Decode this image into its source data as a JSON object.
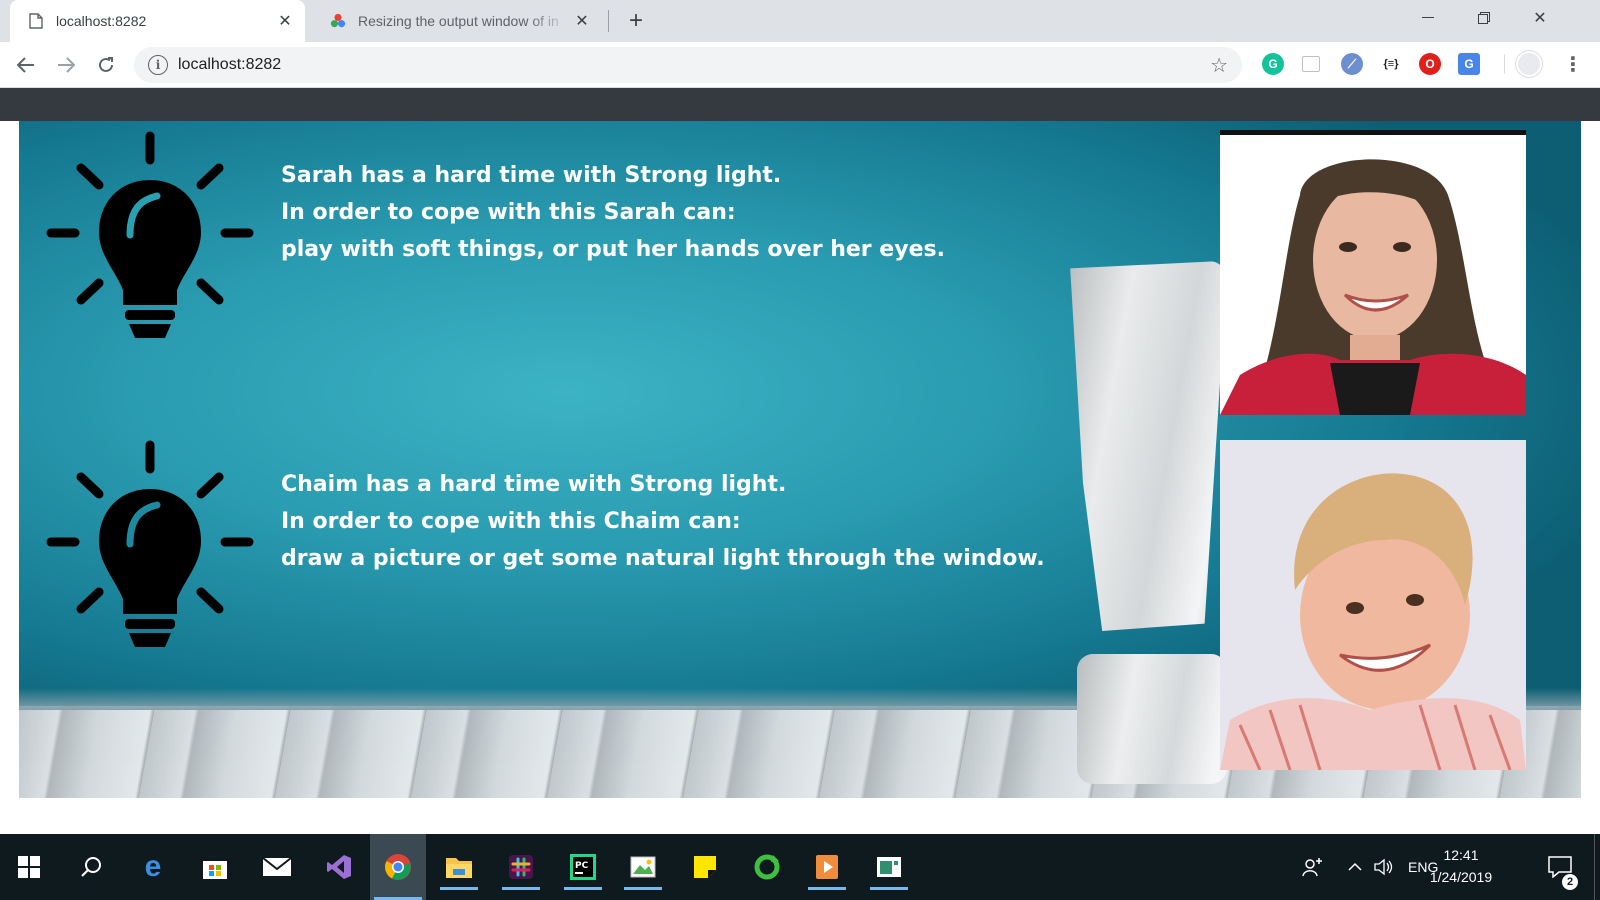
{
  "browser": {
    "tabs": [
      {
        "title": "localhost:8282",
        "active": true
      },
      {
        "title": "Resizing the output window of in",
        "active": false
      }
    ],
    "address_bar": {
      "url": "localhost:8282"
    },
    "extensions": [
      "grammarly-icon",
      "layout-icon",
      "feather-icon",
      "json-icon",
      "opera-icon",
      "translate-icon"
    ]
  },
  "slide": {
    "background_color": "#2a9bb0",
    "messages": [
      {
        "line1": "Sarah has a hard time with Strong light.",
        "line2": "In order to cope with this Sarah can:",
        "line3": "play with soft things, or put her hands over her eyes."
      },
      {
        "line1": "Chaim has a hard time with Strong light.",
        "line2": "In order to cope with this Chaim can:",
        "line3": "draw a picture or get some natural light through the window."
      }
    ]
  },
  "taskbar": {
    "apps": [
      "windows-start",
      "search",
      "edge",
      "store",
      "mail",
      "visual-studio",
      "chrome",
      "file-explorer",
      "slack",
      "pycharm",
      "photos",
      "sticky-notes",
      "refresh-app",
      "media-player",
      "app-window"
    ],
    "language": "ENG",
    "time": "12:41",
    "date": "1/24/2019",
    "notification_count": "2"
  }
}
